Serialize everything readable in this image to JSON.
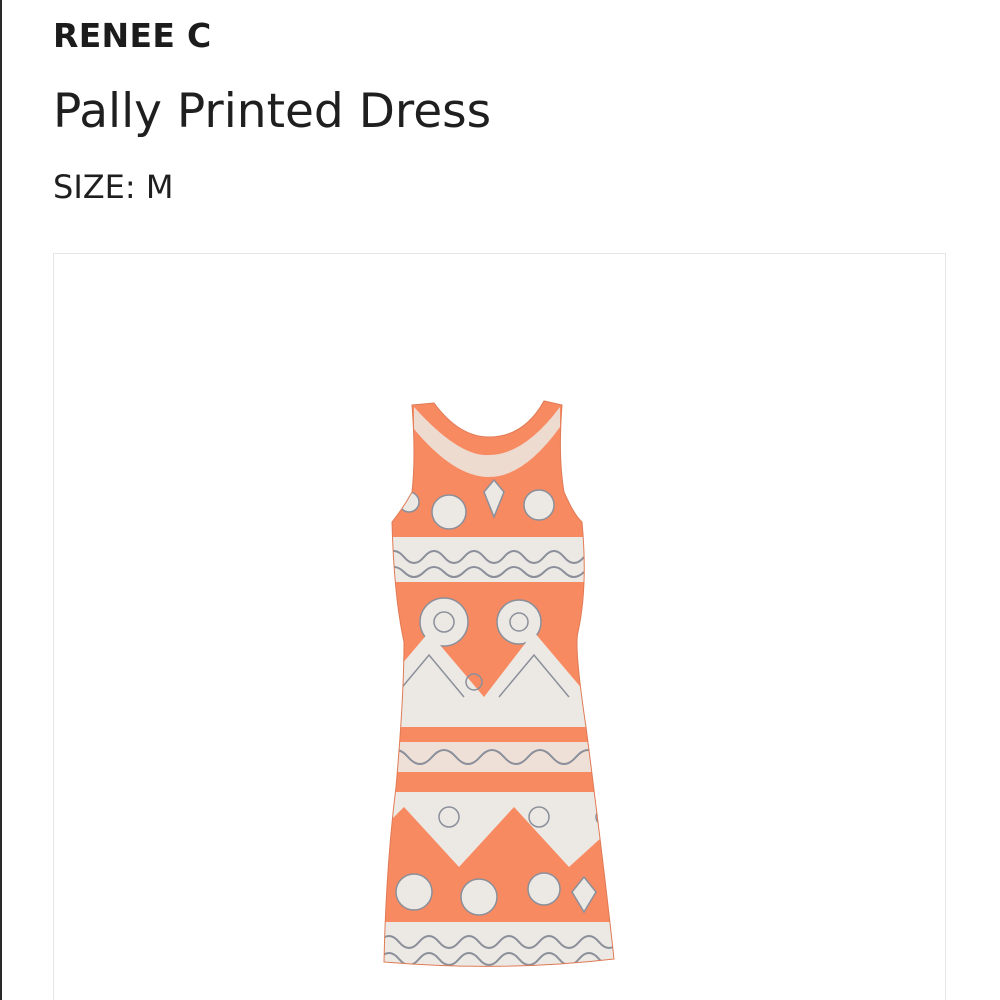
{
  "product": {
    "brand": "RENEE C",
    "name": "Pally Printed Dress",
    "size_label": "SIZE: M"
  },
  "image": {
    "icon": "dress-photo",
    "colors": {
      "fabric": "#f88a62",
      "pattern": "#ece9e4",
      "pattern_line": "#8a8f9a"
    }
  }
}
